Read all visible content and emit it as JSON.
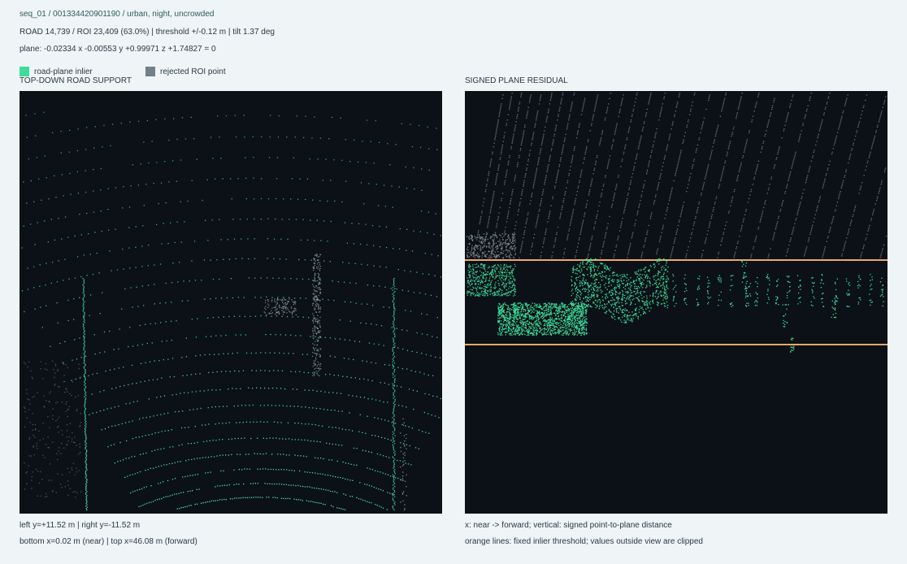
{
  "header": {
    "sequence": "seq_01 / 001334420901190 / urban, night, uncrowded",
    "stats": "ROAD 14,739 / ROI 23,409 (63.0%)  |  threshold +/-0.12 m  |  tilt 1.37 deg",
    "plane": "plane: -0.02334 x -0.00553 y +0.99971 z +1.74827 = 0"
  },
  "legend": {
    "inlier_label": "road-plane inlier",
    "rejected_label": "rejected ROI point"
  },
  "panels": {
    "left_title": "TOP-DOWN ROAD SUPPORT",
    "right_title": "SIGNED PLANE RESIDUAL"
  },
  "footer": {
    "left_line1": "left y=+11.52 m  |  right y=-11.52 m",
    "left_line2": "bottom x=0.02 m (near)  |  top x=46.08 m (forward)",
    "right_line1": "x: near -> forward; vertical: signed point-to-plane distance",
    "right_line2": "orange lines: fixed inlier threshold; values outside view are clipped"
  },
  "colors": {
    "inlier": "#3ddc9a",
    "rejected": "#8a96a0",
    "threshold": "#f0a868",
    "panel_bg": "#0b1117"
  }
}
